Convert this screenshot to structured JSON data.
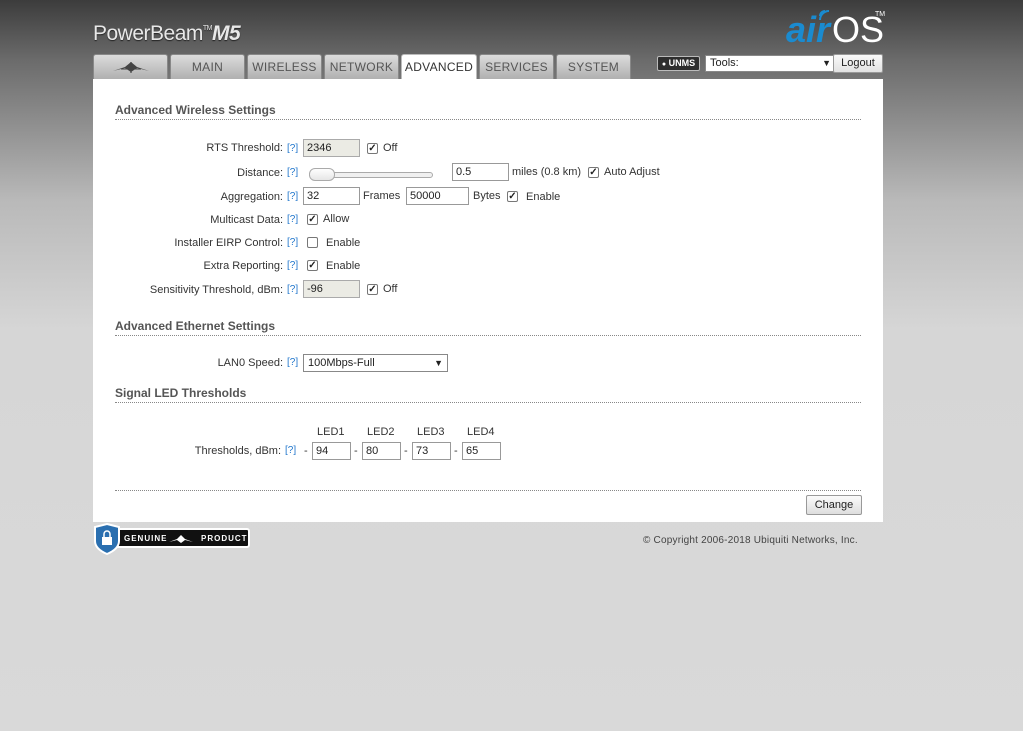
{
  "product": {
    "name": "PowerBeam",
    "tm": "TM",
    "model": "M5"
  },
  "brand": {
    "logo_text": "airOS",
    "tm": "TM"
  },
  "tabs": [
    {
      "label": "",
      "icon": "ubiquiti-logo-icon"
    },
    {
      "label": "MAIN"
    },
    {
      "label": "WIRELESS"
    },
    {
      "label": "NETWORK"
    },
    {
      "label": "ADVANCED"
    },
    {
      "label": "SERVICES"
    },
    {
      "label": "SYSTEM"
    }
  ],
  "active_tab": "ADVANCED",
  "header": {
    "unms_label": "UNMS",
    "tools_value": "Tools:",
    "logout_label": "Logout"
  },
  "help_text": "[?]",
  "wireless": {
    "title": "Advanced Wireless Settings",
    "rts": {
      "label": "RTS Threshold:",
      "value": "2346",
      "checkbox_label": "Off",
      "checked": true
    },
    "distance": {
      "label": "Distance:",
      "value": "0.5",
      "unit": "miles (0.8 km)",
      "checkbox_label": "Auto Adjust",
      "checked": true
    },
    "aggregation": {
      "label": "Aggregation:",
      "frames_value": "32",
      "frames_label": "Frames",
      "bytes_value": "50000",
      "bytes_label": "Bytes",
      "checkbox_label": "Enable",
      "checked": true
    },
    "multicast": {
      "label": "Multicast Data:",
      "checkbox_label": "Allow",
      "checked": true
    },
    "installer_eirp": {
      "label": "Installer EIRP Control:",
      "checkbox_label": "Enable",
      "checked": false
    },
    "extra_reporting": {
      "label": "Extra Reporting:",
      "checkbox_label": "Enable",
      "checked": true
    },
    "sensitivity": {
      "label": "Sensitivity Threshold, dBm:",
      "value": "-96",
      "checkbox_label": "Off",
      "checked": true
    }
  },
  "ethernet": {
    "title": "Advanced Ethernet Settings",
    "lan0": {
      "label": "LAN0 Speed:",
      "value": "100Mbps-Full"
    }
  },
  "led": {
    "title": "Signal LED Thresholds",
    "label": "Thresholds, dBm:",
    "dash": "-",
    "headers": [
      "LED1",
      "LED2",
      "LED3",
      "LED4"
    ],
    "values": [
      "94",
      "80",
      "73",
      "65"
    ]
  },
  "change_label": "Change",
  "footer": {
    "badge_left": "GENUINE",
    "badge_right": "PRODUCT",
    "copyright": "© Copyright 2006-2018 Ubiquiti Networks, Inc."
  },
  "colors": {
    "accent_blue": "#1a8bd0",
    "link": "#2277cc"
  }
}
